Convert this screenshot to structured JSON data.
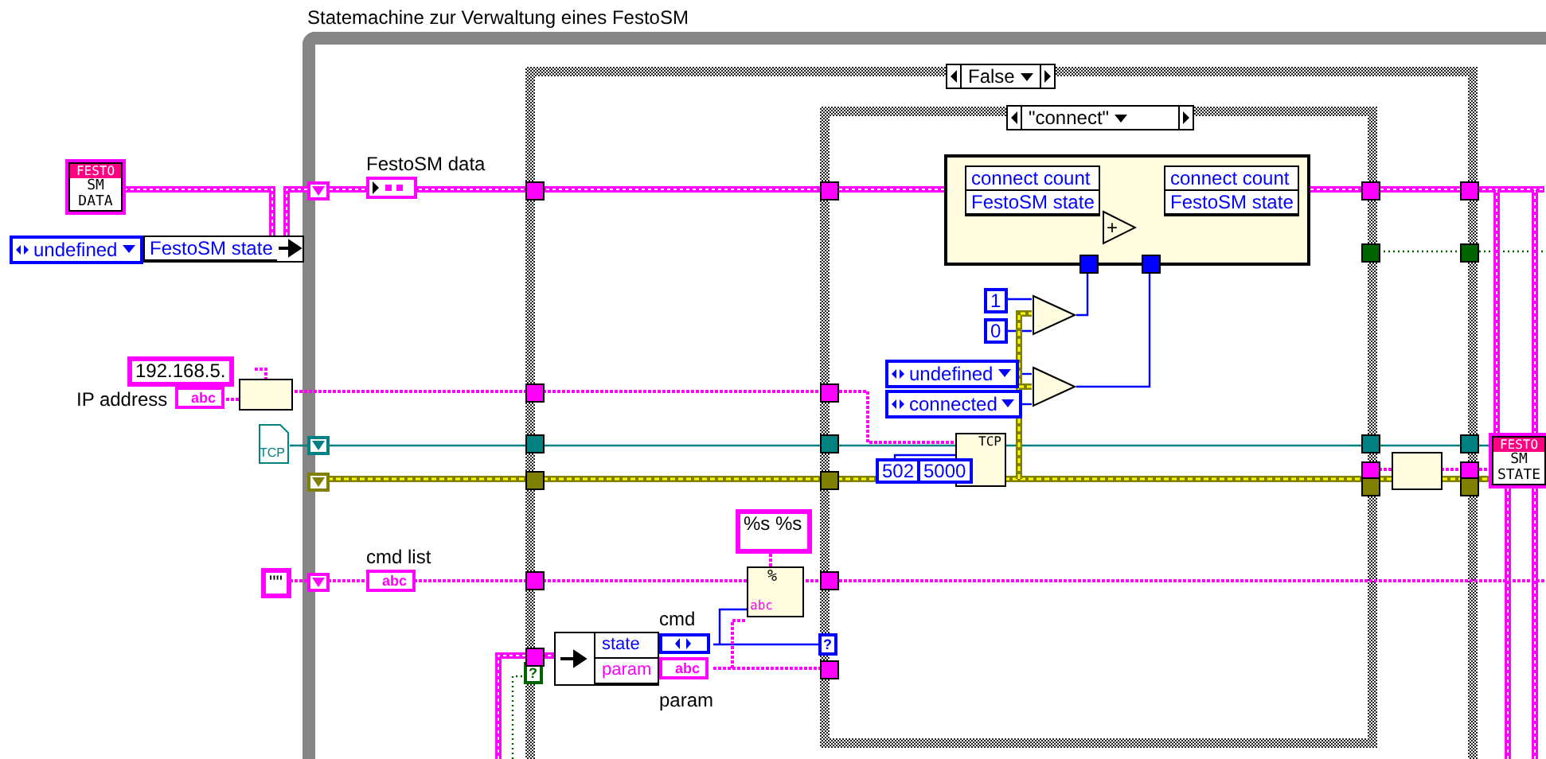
{
  "loop": {
    "label": "Statemachine zur Verwaltung eines FestoSM"
  },
  "outer_case": {
    "selector": "False"
  },
  "inner_case": {
    "selector": "\"connect\""
  },
  "typedefs": [
    {
      "brand": "FESTO",
      "lines": [
        "SM",
        "DATA"
      ]
    },
    {
      "brand": "FESTO",
      "lines": [
        "SM",
        "STATE"
      ]
    }
  ],
  "enum_constants": [
    {
      "value": "undefined"
    },
    {
      "value": "undefined"
    },
    {
      "value": "connected"
    }
  ],
  "labels": [
    "FestoSM data",
    "IP address",
    "cmd list",
    "cmd",
    "param"
  ],
  "string_constants": [
    "192.168.5.",
    "\"\"",
    "%s %s"
  ],
  "string_terminals": [
    "abc",
    "abc",
    "abc"
  ],
  "numeric_constants": [
    "1",
    "0",
    "502",
    "5000"
  ],
  "unbundle_outer": [
    "FestoSM state"
  ],
  "unbundle_cmd": [
    "state",
    "param"
  ],
  "bundle": {
    "inputs": [
      "connect count",
      "FestoSM state"
    ],
    "outputs": [
      "connect count",
      "FestoSM state"
    ],
    "operator": "+"
  },
  "tcp_tags": [
    "TCP",
    "TCP"
  ],
  "format_symbol": "%",
  "format_tag": "abc",
  "case_terminals": [
    "?",
    "?"
  ]
}
